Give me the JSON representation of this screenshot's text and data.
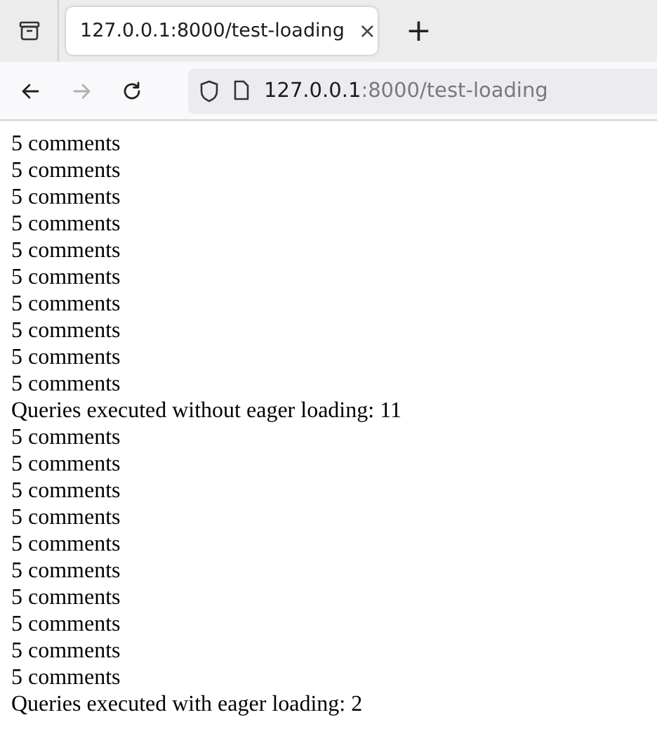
{
  "tabs": [
    {
      "title": "127.0.0.1:8000/test-loading",
      "selected": true,
      "close": "×"
    }
  ],
  "new_tab": "+",
  "toolbar": {
    "back_disabled": false,
    "forward_disabled": true
  },
  "address": {
    "host": "127.0.0.1",
    "rest": ":8000/test-loading"
  },
  "lines": [
    "5 comments",
    "5 comments",
    "5 comments",
    "5 comments",
    "5 comments",
    "5 comments",
    "5 comments",
    "5 comments",
    "5 comments",
    "5 comments",
    "Queries executed without eager loading: 11",
    "5 comments",
    "5 comments",
    "5 comments",
    "5 comments",
    "5 comments",
    "5 comments",
    "5 comments",
    "5 comments",
    "5 comments",
    "5 comments",
    "Queries executed with eager loading: 2"
  ]
}
